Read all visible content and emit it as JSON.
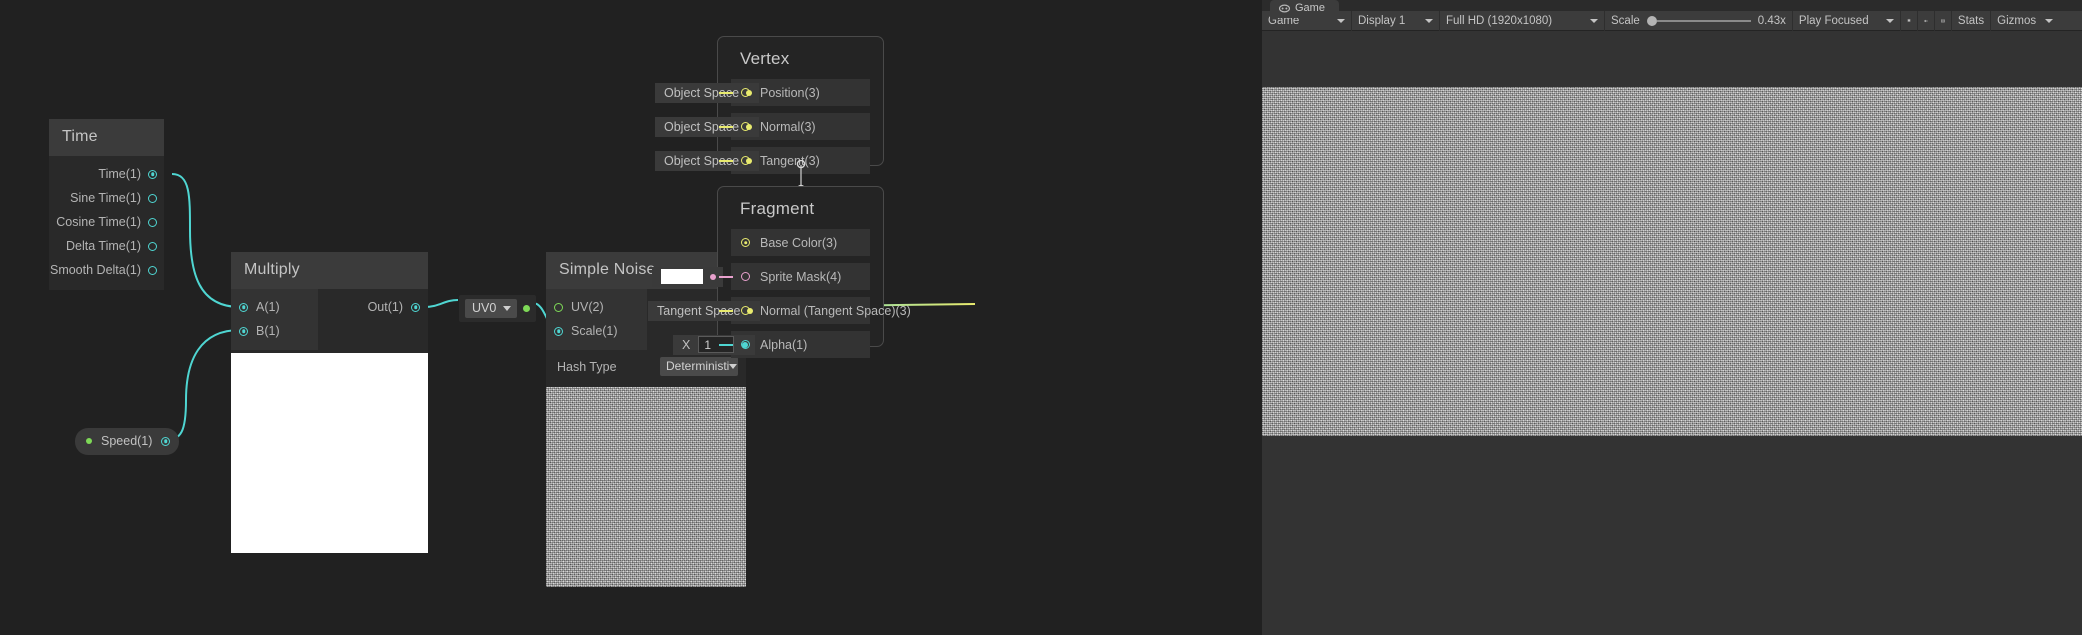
{
  "graph": {
    "nodes": {
      "time": {
        "title": "Time",
        "outputs": [
          {
            "label": "Time(1)",
            "port": "cyan",
            "connected": true
          },
          {
            "label": "Sine Time(1)",
            "port": "cyan",
            "connected": false
          },
          {
            "label": "Cosine Time(1)",
            "port": "cyan",
            "connected": false
          },
          {
            "label": "Delta Time(1)",
            "port": "cyan",
            "connected": false
          },
          {
            "label": "Smooth Delta(1)",
            "port": "cyan",
            "connected": false
          }
        ]
      },
      "multiply": {
        "title": "Multiply",
        "inputs": [
          {
            "label": "A(1)",
            "port": "cyan",
            "connected": true
          },
          {
            "label": "B(1)",
            "port": "cyan",
            "connected": true
          }
        ],
        "outputs": [
          {
            "label": "Out(1)",
            "port": "cyan",
            "connected": true
          }
        ],
        "preview_color": "#ffffff"
      },
      "uv_token": {
        "value": "UV0",
        "icon": "chevron-down-icon"
      },
      "simple_noise": {
        "title": "Simple Noise",
        "inputs": [
          {
            "label": "UV(2)",
            "port": "green",
            "connected": false
          },
          {
            "label": "Scale(1)",
            "port": "cyan",
            "connected": true
          }
        ],
        "outputs": [
          {
            "label": "Out(1)",
            "port": "cyan",
            "connected": true
          }
        ],
        "param_label": "Hash Type",
        "param_value": "Deterministi"
      },
      "speed_property": {
        "label": "Speed(1)",
        "port": "cyan",
        "bullet_color": "#7ed957"
      }
    },
    "master_vertex": {
      "title": "Vertex",
      "rows": [
        {
          "label": "Position(3)",
          "port": "yellow",
          "connected": false,
          "chip": {
            "type": "dropdown",
            "value": "Object Space",
            "pin": "yellow"
          }
        },
        {
          "label": "Normal(3)",
          "port": "yellow",
          "connected": false,
          "chip": {
            "type": "dropdown",
            "value": "Object Space",
            "pin": "yellow"
          }
        },
        {
          "label": "Tangent(3)",
          "port": "yellow",
          "connected": false,
          "chip": {
            "type": "dropdown",
            "value": "Object Space",
            "pin": "yellow"
          }
        }
      ]
    },
    "master_fragment": {
      "title": "Fragment",
      "rows": [
        {
          "label": "Base Color(3)",
          "port": "yellow",
          "connected": true,
          "chip": null
        },
        {
          "label": "Sprite Mask(4)",
          "port": "pink",
          "connected": false,
          "chip": {
            "type": "color",
            "value": "#ffffff",
            "pin": "pink"
          }
        },
        {
          "label": "Normal (Tangent Space)(3)",
          "port": "yellow",
          "connected": false,
          "chip": {
            "type": "dropdown",
            "value": "Tangent Space",
            "pin": "yellow"
          }
        },
        {
          "label": "Alpha(1)",
          "port": "cyan",
          "connected": false,
          "chip": {
            "type": "vector1",
            "axis": "X",
            "value": "1",
            "pin": "cyan"
          }
        }
      ]
    },
    "colors": {
      "wire_cyan": "#4fd6d2",
      "wire_green": "#7ed957",
      "wire_yellow": "#e8ea6e",
      "wire_pink": "#e8a0cd",
      "node_body": "#292929",
      "node_header": "#3b3b3b",
      "canvas": "#212121"
    }
  },
  "gameview": {
    "tab": {
      "label": "Game",
      "icon": "game-icon"
    },
    "toolbar": {
      "view_mode": "Game",
      "display": "Display 1",
      "resolution": "Full HD (1920x1080)",
      "scale_label": "Scale",
      "scale_value": "0.43x",
      "play_mode": "Play Focused",
      "profiler_icon": "bug-icon",
      "mute_icon": "speaker-icon",
      "stats_grid_icon": "grid-icon",
      "stats_label": "Stats",
      "gizmos_label": "Gizmos"
    }
  }
}
